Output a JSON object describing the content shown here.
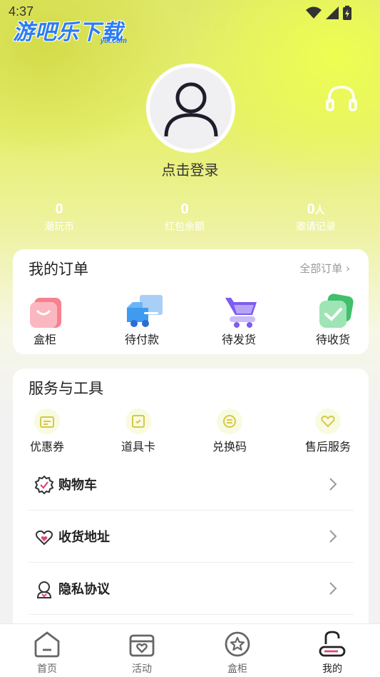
{
  "status": {
    "time": "4:37"
  },
  "watermark": {
    "main": "游吧乐下载",
    "sub": "y8l.com"
  },
  "profile": {
    "login_text": "点击登录"
  },
  "stats": [
    {
      "value": "0",
      "unit": "",
      "label": "潮玩币"
    },
    {
      "value": "0",
      "unit": "",
      "label": "红包余额"
    },
    {
      "value": "0",
      "unit": "人",
      "label": "邀请记录"
    }
  ],
  "orders": {
    "title": "我的订单",
    "more": "全部订单 ›",
    "items": [
      {
        "label": "盒柜",
        "icon": "bag-icon"
      },
      {
        "label": "待付款",
        "icon": "truck-icon"
      },
      {
        "label": "待发货",
        "icon": "cart-icon"
      },
      {
        "label": "待收货",
        "icon": "check-box-icon"
      }
    ]
  },
  "services": {
    "title": "服务与工具",
    "tools": [
      {
        "label": "优惠券",
        "icon": "coupon-icon"
      },
      {
        "label": "道具卡",
        "icon": "card-icon"
      },
      {
        "label": "兑换码",
        "icon": "exchange-icon"
      },
      {
        "label": "售后服务",
        "icon": "heart-icon"
      }
    ],
    "rows": [
      {
        "label": "购物车",
        "icon": "cart-badge-icon"
      },
      {
        "label": "收货地址",
        "icon": "heart-location-icon"
      },
      {
        "label": "隐私协议",
        "icon": "privacy-icon"
      }
    ]
  },
  "tabbar": [
    {
      "label": "首页",
      "icon": "home-icon"
    },
    {
      "label": "活动",
      "icon": "gift-box-icon"
    },
    {
      "label": "盒柜",
      "icon": "star-circle-icon"
    },
    {
      "label": "我的",
      "icon": "profile-icon"
    }
  ],
  "colors": {
    "accent": "#e8f060",
    "brand_yellow": "#eef56a",
    "text": "#222222",
    "muted": "#999999"
  }
}
